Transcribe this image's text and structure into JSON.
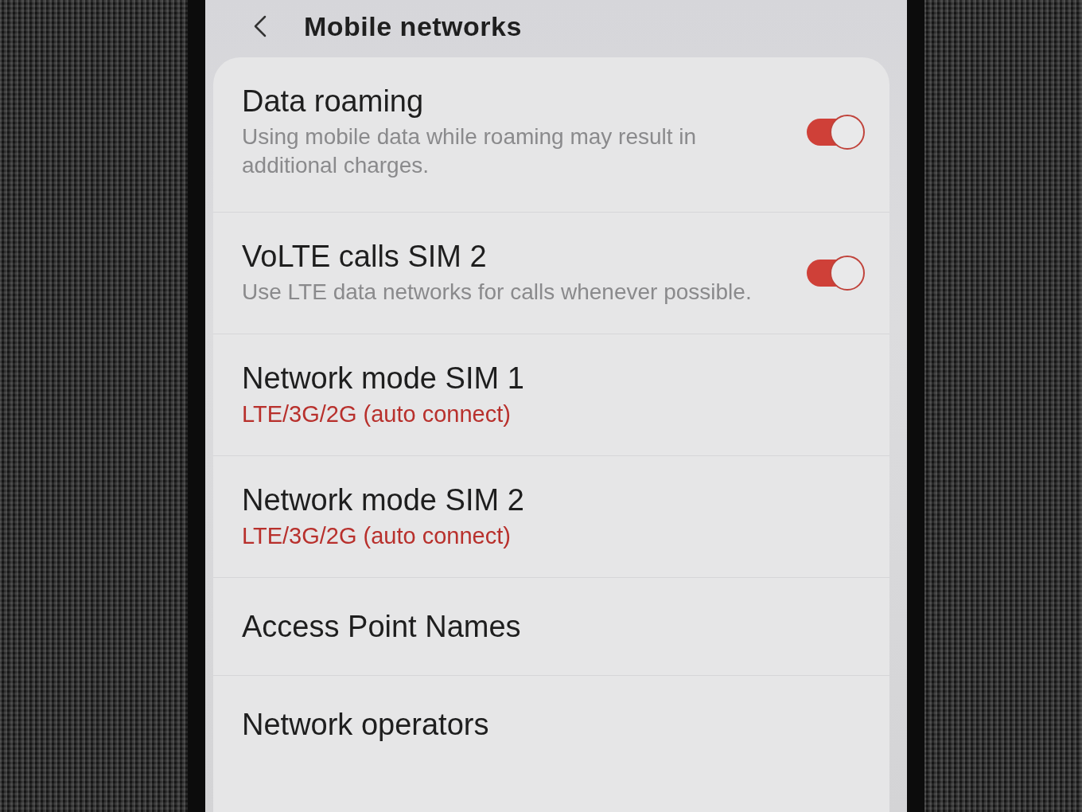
{
  "header": {
    "title": "Mobile networks"
  },
  "settings": [
    {
      "kind": "toggle",
      "title": "Data roaming",
      "description": "Using mobile data while roaming may result in additional charges.",
      "on": true
    },
    {
      "kind": "toggle",
      "title": "VoLTE calls SIM 2",
      "description": "Use LTE data networks for calls whenever possible.",
      "on": true
    },
    {
      "kind": "option",
      "title": "Network mode SIM 1",
      "value": "LTE/3G/2G (auto connect)"
    },
    {
      "kind": "option",
      "title": "Network mode SIM 2",
      "value": "LTE/3G/2G (auto connect)"
    },
    {
      "kind": "link",
      "title": "Access Point Names"
    },
    {
      "kind": "link",
      "title": "Network operators"
    }
  ]
}
